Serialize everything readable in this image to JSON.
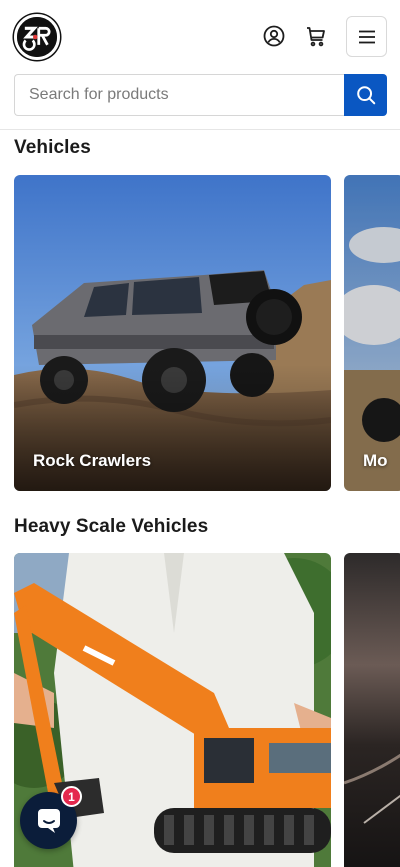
{
  "header": {
    "logo_alt": "DZRC logo",
    "search": {
      "placeholder": "Search for products",
      "value": ""
    }
  },
  "sections": [
    {
      "title": "Vehicles",
      "cards": [
        {
          "label": "Rock Crawlers"
        },
        {
          "label": "Mo"
        }
      ]
    },
    {
      "title": "Heavy Scale Vehicles",
      "cards": [
        {
          "label": ""
        },
        {
          "label": ""
        }
      ]
    }
  ],
  "chat": {
    "badge_count": "1"
  },
  "colors": {
    "accent": "#0a57c2",
    "chat_bg": "#0b1d3a",
    "badge": "#e4284d"
  },
  "icons": [
    "account-icon",
    "cart-icon",
    "menu-icon",
    "search-icon",
    "chat-icon"
  ]
}
